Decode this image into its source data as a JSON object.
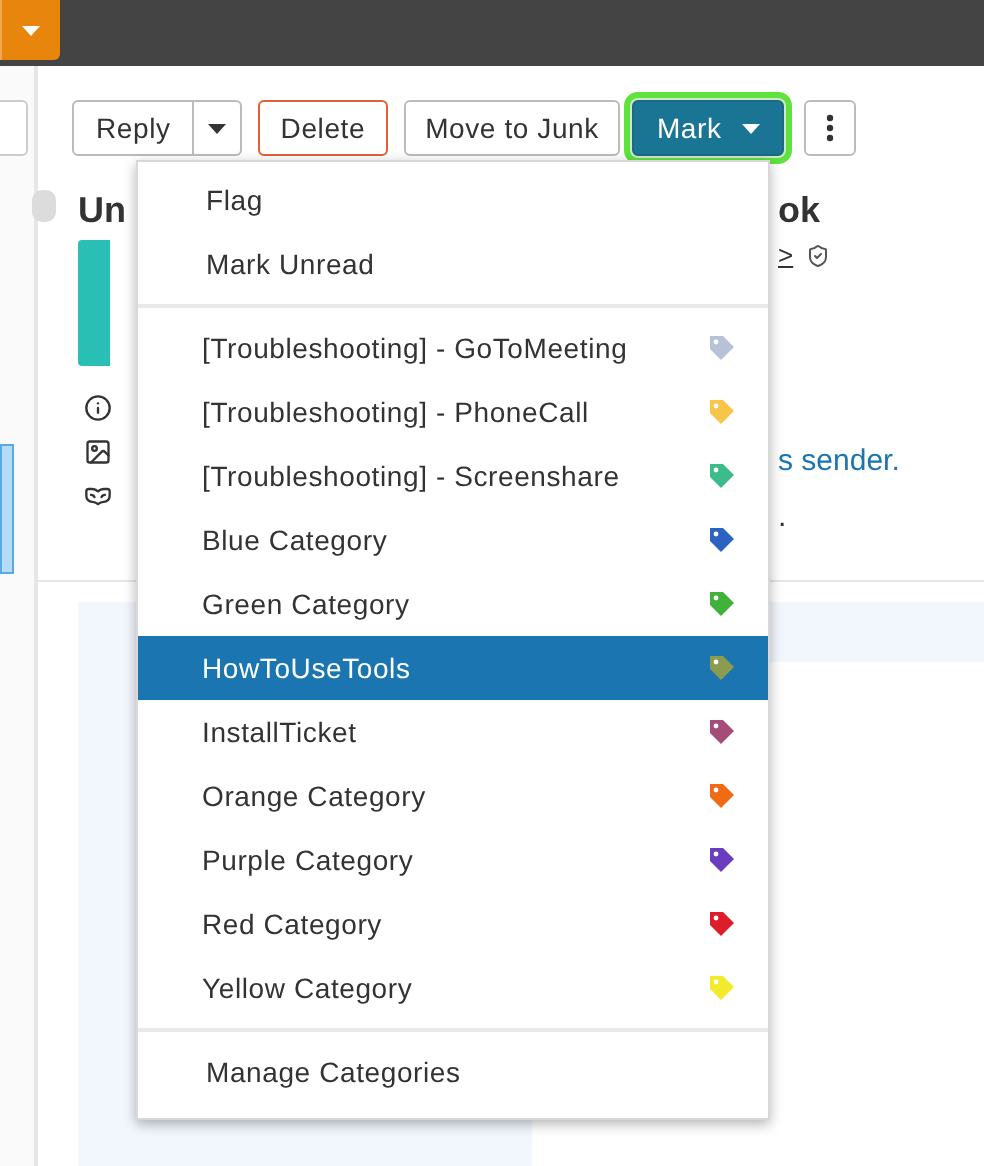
{
  "toolbar": [
    {
      "kind": "split",
      "label": "Reply"
    },
    {
      "kind": "danger",
      "label": "Delete"
    },
    {
      "kind": "plain",
      "label": "Move to Junk"
    },
    {
      "kind": "primary",
      "label": "Mark",
      "highlighted": true
    },
    {
      "kind": "more"
    }
  ],
  "message": {
    "subject_start": "Un",
    "subject_end": "ok",
    "sender_end": ">",
    "trust_link": "s sender.",
    "note_end": "."
  },
  "menu": {
    "sections": [
      [
        {
          "kind": "action",
          "label": "Flag",
          "selected": false
        },
        {
          "kind": "action",
          "label": "Mark Unread",
          "selected": false
        }
      ],
      [
        {
          "kind": "category",
          "label": "[Troubleshooting] - GoToMeeting",
          "color": "#b8c2d6",
          "selected": false
        },
        {
          "kind": "category",
          "label": "[Troubleshooting] - PhoneCall",
          "color": "#f7c548",
          "selected": false
        },
        {
          "kind": "category",
          "label": "[Troubleshooting] - Screenshare",
          "color": "#3dbb8a",
          "selected": false
        },
        {
          "kind": "category",
          "label": "Blue Category",
          "color": "#2a64c0",
          "selected": false
        },
        {
          "kind": "category",
          "label": "Green Category",
          "color": "#40b23c",
          "selected": false
        },
        {
          "kind": "category",
          "label": "HowToUseTools",
          "color": "#8c9b4e",
          "selected": true
        },
        {
          "kind": "category",
          "label": "InstallTicket",
          "color": "#a64c78",
          "selected": false
        },
        {
          "kind": "category",
          "label": "Orange Category",
          "color": "#f06c14",
          "selected": false
        },
        {
          "kind": "category",
          "label": "Purple Category",
          "color": "#6a3cc0",
          "selected": false
        },
        {
          "kind": "category",
          "label": "Red Category",
          "color": "#dc1e2a",
          "selected": false
        },
        {
          "kind": "category",
          "label": "Yellow Category",
          "color": "#f2ea2c",
          "selected": false
        }
      ],
      [
        {
          "kind": "action",
          "label": "Manage Categories",
          "selected": false
        }
      ]
    ]
  }
}
